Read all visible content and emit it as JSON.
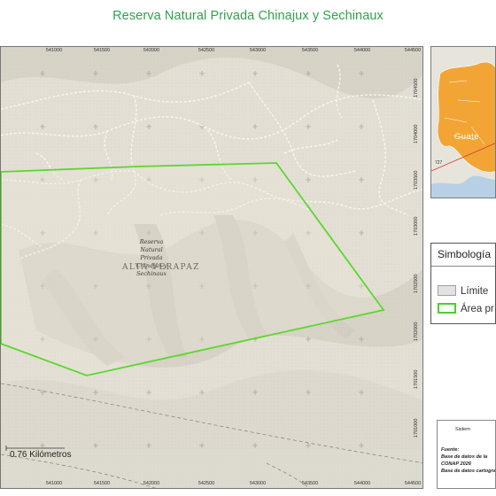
{
  "title": "Reserva Natural Privada Chinajux y Sechinaux",
  "map": {
    "x_ticks": [
      "541000",
      "541500",
      "542000",
      "542500",
      "543000",
      "543500",
      "544000",
      "544500"
    ],
    "y_ticks": [
      "1704500",
      "1704000",
      "1703500",
      "1703000",
      "1702500",
      "1702000",
      "1701500",
      "1701000"
    ],
    "reserve_label": [
      "Reserva",
      "Natural",
      "Privada",
      "Chinajux y",
      "Sechinaux"
    ],
    "department_label": "ALTA VERAPAZ",
    "scale_label": "0.76 Kilómetros"
  },
  "inset": {
    "country_label": "Guate",
    "marker_label": "727"
  },
  "legend": {
    "title": "Simbología",
    "items": [
      {
        "label": "Límite"
      },
      {
        "label": "Área pr"
      }
    ]
  },
  "credits": {
    "header": "Sistem",
    "source_label": "Fuente:",
    "lines": [
      "Base de datos de la",
      "CONAP 2026",
      "Base de datos cartogra"
    ]
  },
  "colors": {
    "title": "#2ea24a",
    "boundary": "#5ad82e",
    "inset_highlight": "#f2a535"
  }
}
